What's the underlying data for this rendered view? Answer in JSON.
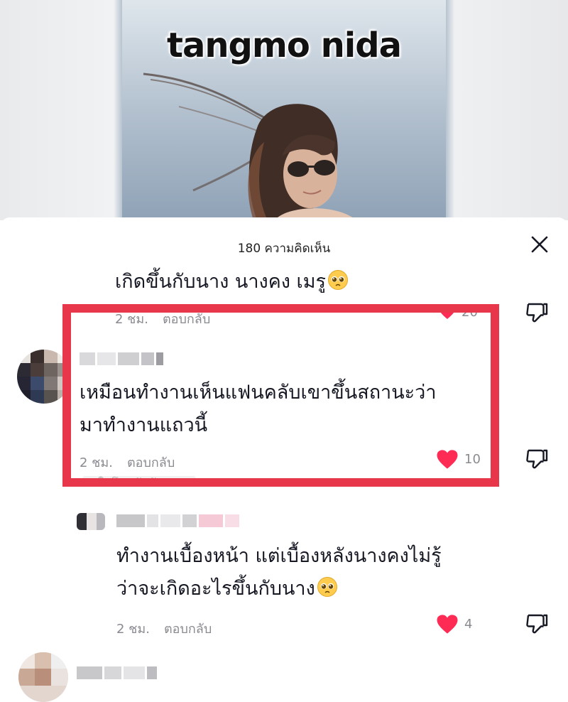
{
  "video": {
    "caption": "tangmo nida"
  },
  "sheet": {
    "header": "180 ความคิดเห็น",
    "close_icon": "close-icon"
  },
  "comments": [
    {
      "text_lines": [
        "เกิดขึ้นกับนาง นางคง เมรู"
      ],
      "emoji": "pleading-face",
      "time": "2 ชม.",
      "reply": "ตอบกลับ",
      "likes": "20"
    },
    {
      "text_lines": [
        "เหมือนทำงานเห็นแฟนคลับเขาขึ้นสถานะว่า",
        "มาทำงานแถวนี้"
      ],
      "time": "2 ชม.",
      "reply": "ตอบกลับ",
      "likes": "10",
      "creator_liked": "ถูกใจโดยผู้สร้าง"
    },
    {
      "text_lines": [
        "ทำงานเบื้องหน้า แต่เบื้องหลังนางคงไม่รู้",
        "ว่าจะเกิดอะไรขึ้นกับนาง"
      ],
      "emoji": "pleading-face",
      "time": "2 ชม.",
      "reply": "ตอบกลับ",
      "likes": "4"
    }
  ],
  "colors": {
    "like_heart": "#fe2c55",
    "highlight_border": "#e8364a",
    "meta_text": "#8a8b91"
  },
  "icons": [
    "heart-icon",
    "dislike-icon",
    "close-icon",
    "pleading-face-emoji"
  ]
}
